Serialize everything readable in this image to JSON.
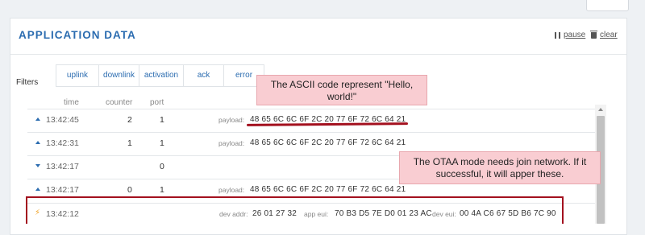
{
  "panel": {
    "title": "APPLICATION DATA",
    "pause_label": "pause",
    "clear_label": "clear"
  },
  "filters": {
    "label": "Filters",
    "tabs": [
      "uplink",
      "downlink",
      "activation",
      "ack",
      "error"
    ]
  },
  "columns": {
    "time": "time",
    "counter": "counter",
    "port": "port"
  },
  "rows": [
    {
      "icon": "uplink-arrow-icon",
      "time": "13:42:45",
      "counter": "2",
      "port": "1",
      "payload_label": "payload:",
      "payload": "48 65 6C 6C 6F 2C 20 77 6F 72 6C 64 21"
    },
    {
      "icon": "uplink-arrow-icon",
      "time": "13:42:31",
      "counter": "1",
      "port": "1",
      "payload_label": "payload:",
      "payload": "48 65 6C 6C 6F 2C 20 77 6F 72 6C 64 21"
    },
    {
      "icon": "downlink-arrow-icon",
      "time": "13:42:17",
      "counter": "",
      "port": "0"
    },
    {
      "icon": "uplink-arrow-icon",
      "time": "13:42:17",
      "counter": "0",
      "port": "1",
      "payload_label": "payload:",
      "payload": "48 65 6C 6C 6F 2C 20 77 6F 72 6C 64 21"
    },
    {
      "icon": "activation-bolt-icon",
      "time": "13:42:12",
      "dev_addr_label": "dev addr:",
      "dev_addr": "26 01 27 32",
      "app_eui_label": "app eui:",
      "app_eui": "70 B3 D5 7E D0 01 23 AC",
      "dev_eui_label": "dev eui:",
      "dev_eui": "00 4A C6 67 5D B6 7C 90"
    }
  ],
  "annotations": {
    "ascii_note": "The ASCII code represent \"Hello, world!\"",
    "otaa_note": "The OTAA mode needs join network. If it successful, it will apper these."
  },
  "colors": {
    "accent": "#2b6cb0",
    "annotation_fill": "#f9cdd2",
    "annotation_mark": "#a3101e",
    "activation_icon": "#f0a020"
  }
}
